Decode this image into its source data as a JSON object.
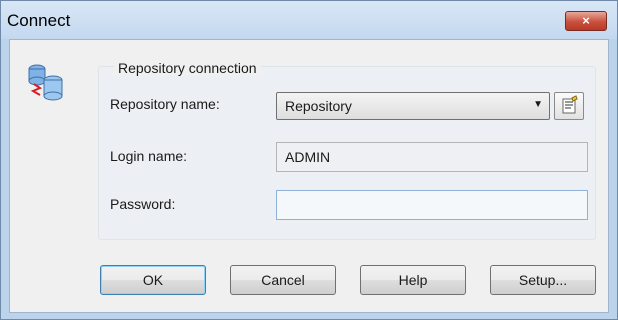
{
  "window": {
    "title": "Connect",
    "close_label": "×"
  },
  "group": {
    "label": "Repository connection"
  },
  "repository": {
    "label": "Repository name:",
    "value": "Repository"
  },
  "login": {
    "label": "Login name:",
    "value": "ADMIN"
  },
  "password": {
    "label": "Password:",
    "value": ""
  },
  "buttons": {
    "ok": "OK",
    "cancel": "Cancel",
    "help": "Help",
    "setup": "Setup..."
  },
  "icons": {
    "dialog_icon": "database-connection-icon",
    "properties_icon": "properties-icon",
    "dropdown": "chevron-down-icon"
  }
}
